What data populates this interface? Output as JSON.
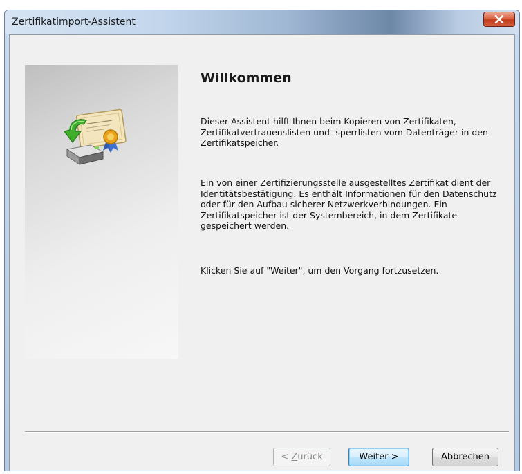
{
  "window": {
    "title": "Zertifikatimport-Assistent",
    "close_label": "x"
  },
  "page": {
    "heading": "Willkommen",
    "paragraphs": [
      "Dieser Assistent hilft Ihnen beim Kopieren von Zertifikaten, Zertifikatvertrauenslisten und -sperrlisten vom Datenträger in den Zertifikatspeicher.",
      "Ein von einer Zertifizierungsstelle ausgestelltes Zertifikat dient der Identitätsbestätigung. Es enthält Informationen für den Datenschutz oder für den Aufbau sicherer Netzwerkverbindungen. Ein Zertifikatspeicher ist der Systembereich, in dem Zertifikate gespeichert werden.",
      "Klicken Sie auf \"Weiter\", um den Vorgang fortzusetzen."
    ]
  },
  "buttons": {
    "back_prefix": "< ",
    "back_hotkey": "Z",
    "back_rest": "urück",
    "next_label": "Weiter >",
    "cancel_label": "Abbrechen"
  },
  "icons": {
    "wizard_icon": "certificate-import-icon",
    "close_icon": "close-icon"
  },
  "colors": {
    "close_button": "#c13b1a",
    "title_bar": "#c3d6ec",
    "default_button_border": "#3c7fb1"
  }
}
